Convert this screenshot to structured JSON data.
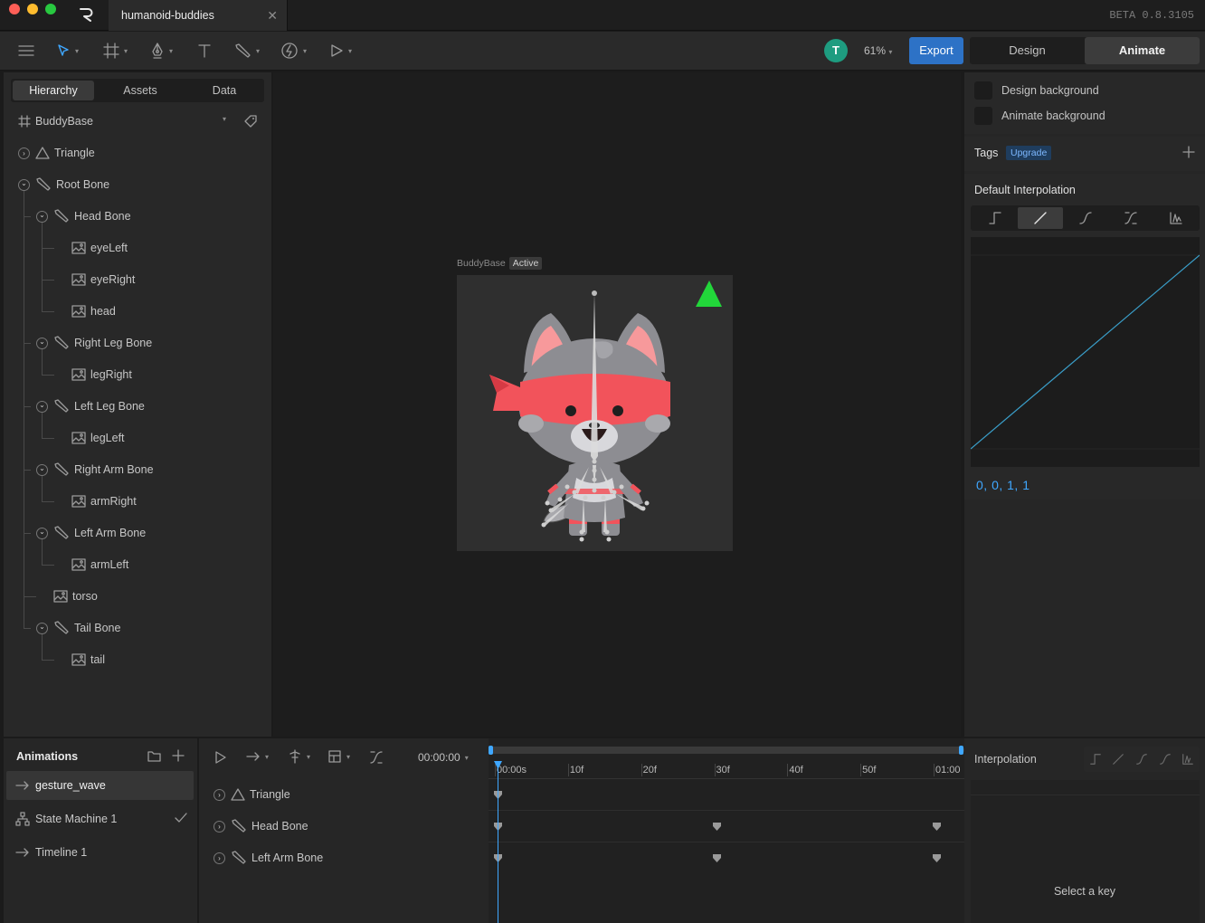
{
  "window": {
    "document_tab": "humanoid-buddies",
    "version": "BETA 0.8.3105"
  },
  "toolbar": {
    "tools": [
      "menu-icon",
      "select-icon",
      "artboard-icon",
      "pen-icon",
      "text-icon",
      "bone-icon",
      "procedural-icon",
      "play-icon"
    ],
    "avatar_initial": "T",
    "zoom": "61%",
    "export_label": "Export",
    "modes": [
      "Design",
      "Animate"
    ],
    "active_mode": "Animate"
  },
  "left_panel": {
    "tabs": [
      "Hierarchy",
      "Assets",
      "Data"
    ],
    "active_tab": "Hierarchy",
    "root": "BuddyBase",
    "tree": [
      {
        "label": "Triangle",
        "type": "shape",
        "depth": 0,
        "expander": "collapsed"
      },
      {
        "label": "Root Bone",
        "type": "bone",
        "depth": 0,
        "expander": "expanded"
      },
      {
        "label": "Head Bone",
        "type": "bone",
        "depth": 1,
        "expander": "expanded"
      },
      {
        "label": "eyeLeft",
        "type": "image",
        "depth": 2
      },
      {
        "label": "eyeRight",
        "type": "image",
        "depth": 2
      },
      {
        "label": "head",
        "type": "image",
        "depth": 2
      },
      {
        "label": "Right Leg Bone",
        "type": "bone",
        "depth": 1,
        "expander": "expanded"
      },
      {
        "label": "legRight",
        "type": "image",
        "depth": 2
      },
      {
        "label": "Left Leg Bone",
        "type": "bone",
        "depth": 1,
        "expander": "expanded"
      },
      {
        "label": "legLeft",
        "type": "image",
        "depth": 2
      },
      {
        "label": "Right Arm Bone",
        "type": "bone",
        "depth": 1,
        "expander": "expanded"
      },
      {
        "label": "armRight",
        "type": "image",
        "depth": 2
      },
      {
        "label": "Left Arm Bone",
        "type": "bone",
        "depth": 1,
        "expander": "expanded"
      },
      {
        "label": "armLeft",
        "type": "image",
        "depth": 2
      },
      {
        "label": "torso",
        "type": "image",
        "depth": 1
      },
      {
        "label": "Tail Bone",
        "type": "bone",
        "depth": 1,
        "expander": "expanded"
      },
      {
        "label": "tail",
        "type": "image",
        "depth": 2
      }
    ]
  },
  "canvas": {
    "artboard_name": "BuddyBase",
    "artboard_state": "Active"
  },
  "right_panel": {
    "design_background": "Design background",
    "animate_background": "Animate background",
    "tags_label": "Tags",
    "upgrade_label": "Upgrade",
    "default_interpolation_label": "Default Interpolation",
    "interpolation_modes": [
      "hold",
      "linear",
      "cubic",
      "elastic",
      "custom"
    ],
    "active_interpolation": "linear",
    "cubic_values": "0, 0, 1, 1"
  },
  "animations": {
    "title": "Animations",
    "items": [
      {
        "label": "gesture_wave",
        "icon": "timeline-arrow-icon",
        "selected": true
      },
      {
        "label": "State Machine 1",
        "icon": "state-machine-icon",
        "checked": true
      },
      {
        "label": "Timeline 1",
        "icon": "timeline-arrow-icon"
      }
    ]
  },
  "timeline": {
    "timecode": "00:00:00",
    "ticks": [
      "00:00s",
      "10f",
      "20f",
      "30f",
      "40f",
      "50f",
      "01:00"
    ],
    "tracks": [
      {
        "label": "Triangle",
        "icon": "triangle-icon",
        "keys": [
          0
        ]
      },
      {
        "label": "Head Bone",
        "icon": "bone-icon",
        "keys": [
          0,
          30,
          60
        ]
      },
      {
        "label": "Left Arm Bone",
        "icon": "bone-icon",
        "keys": [
          0,
          30,
          60
        ]
      }
    ],
    "frame_range": [
      0,
      60
    ],
    "playhead_frame": 0
  },
  "interpolation_panel": {
    "title": "Interpolation",
    "empty_message": "Select a key"
  },
  "colors": {
    "accent_blue": "#2d72c6",
    "avatar_green": "#1e9c80",
    "curve_line": "#3a9ec9",
    "triangle_green": "#22d63a",
    "bandana_red": "#f2535b"
  }
}
